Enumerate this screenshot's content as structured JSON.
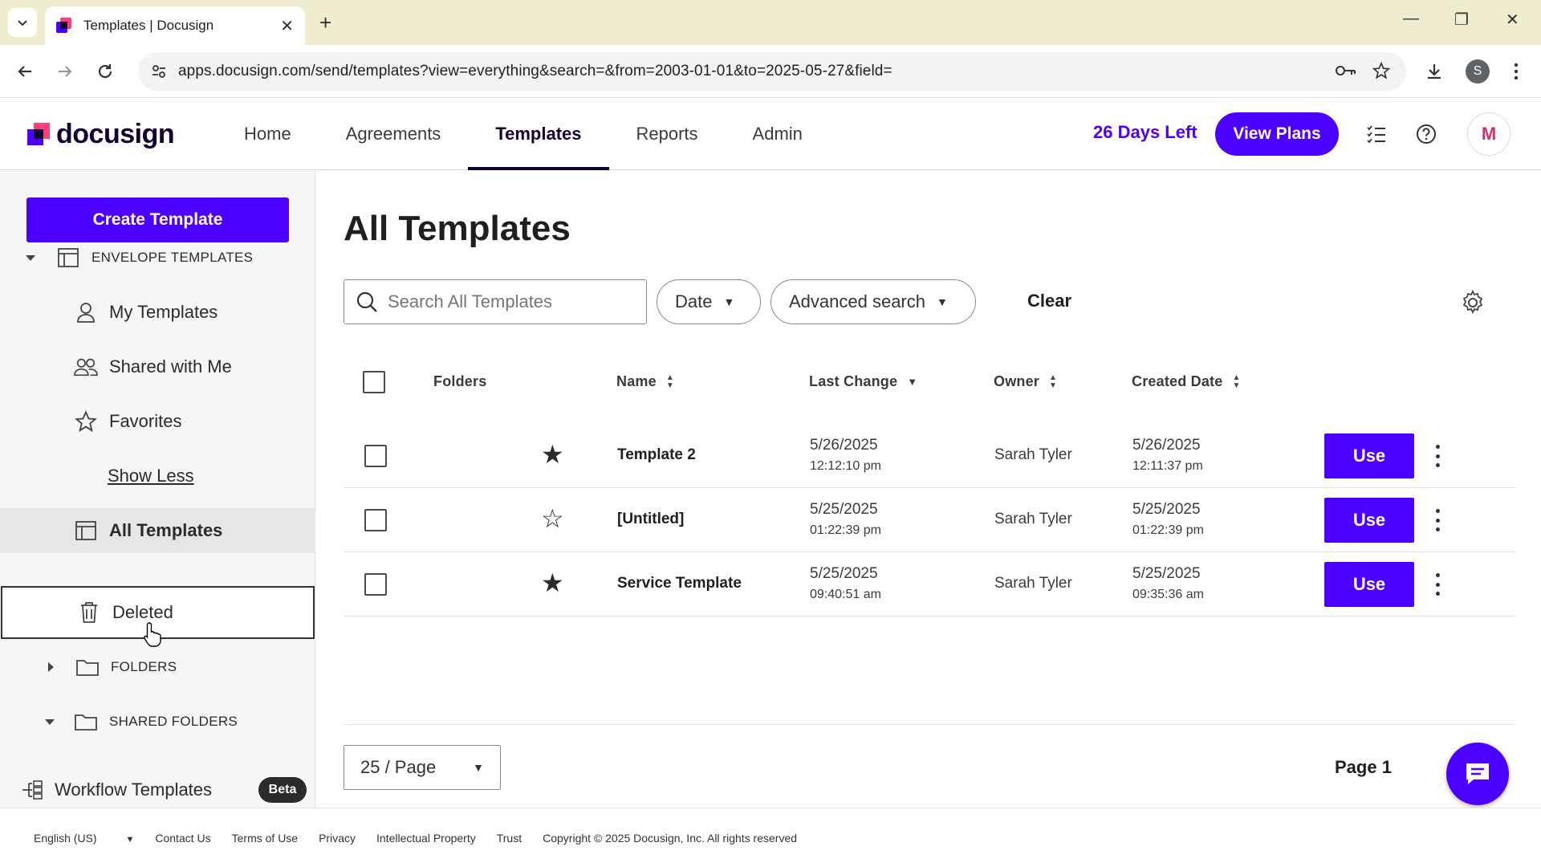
{
  "browser": {
    "tab_title": "Templates | Docusign",
    "url": "apps.docusign.com/send/templates?view=everything&search=&from=2003-01-01&to=2025-05-27&field=",
    "profile_initial": "S"
  },
  "header": {
    "logo_text": "docusign",
    "nav": [
      "Home",
      "Agreements",
      "Templates",
      "Reports",
      "Admin"
    ],
    "active_nav": "Templates",
    "trial_text": "26 Days Left",
    "view_plans_label": "View Plans",
    "avatar_initial": "M"
  },
  "sidebar": {
    "create_label": "Create Template",
    "envelope_templates": "ENVELOPE TEMPLATES",
    "my_templates": "My Templates",
    "shared_with_me": "Shared with Me",
    "favorites": "Favorites",
    "show_less": "Show Less",
    "all_templates": "All Templates",
    "deleted": "Deleted",
    "folders": "FOLDERS",
    "shared_folders": "SHARED FOLDERS",
    "workflow_templates": "Workflow Templates",
    "beta_badge": "Beta"
  },
  "main": {
    "title": "All Templates",
    "search_placeholder": "Search All Templates",
    "date_filter": "Date",
    "advanced_search": "Advanced search",
    "clear_label": "Clear",
    "columns": {
      "folders": "Folders",
      "name": "Name",
      "last_change": "Last Change",
      "owner": "Owner",
      "created_date": "Created Date"
    },
    "use_label": "Use",
    "rows": [
      {
        "starred": true,
        "name": "Template 2",
        "last_change_date": "5/26/2025",
        "last_change_time": "12:12:10 pm",
        "owner": "Sarah Tyler",
        "created_date": "5/26/2025",
        "created_time": "12:11:37 pm"
      },
      {
        "starred": false,
        "name": "[Untitled]",
        "last_change_date": "5/25/2025",
        "last_change_time": "01:22:39 pm",
        "owner": "Sarah Tyler",
        "created_date": "5/25/2025",
        "created_time": "01:22:39 pm"
      },
      {
        "starred": true,
        "name": "Service Template",
        "last_change_date": "5/25/2025",
        "last_change_time": "09:40:51 am",
        "owner": "Sarah Tyler",
        "created_date": "5/25/2025",
        "created_time": "09:35:36 am"
      }
    ],
    "per_page": "25 / Page",
    "page_label": "Page 1"
  },
  "footer": {
    "language": "English (US)",
    "links": [
      "Contact Us",
      "Terms of Use",
      "Privacy",
      "Intellectual Property",
      "Trust"
    ],
    "copyright": "Copyright © 2025 Docusign, Inc. All rights reserved"
  },
  "colors": {
    "accent": "#4c00ff",
    "brand_dark": "#130032"
  }
}
